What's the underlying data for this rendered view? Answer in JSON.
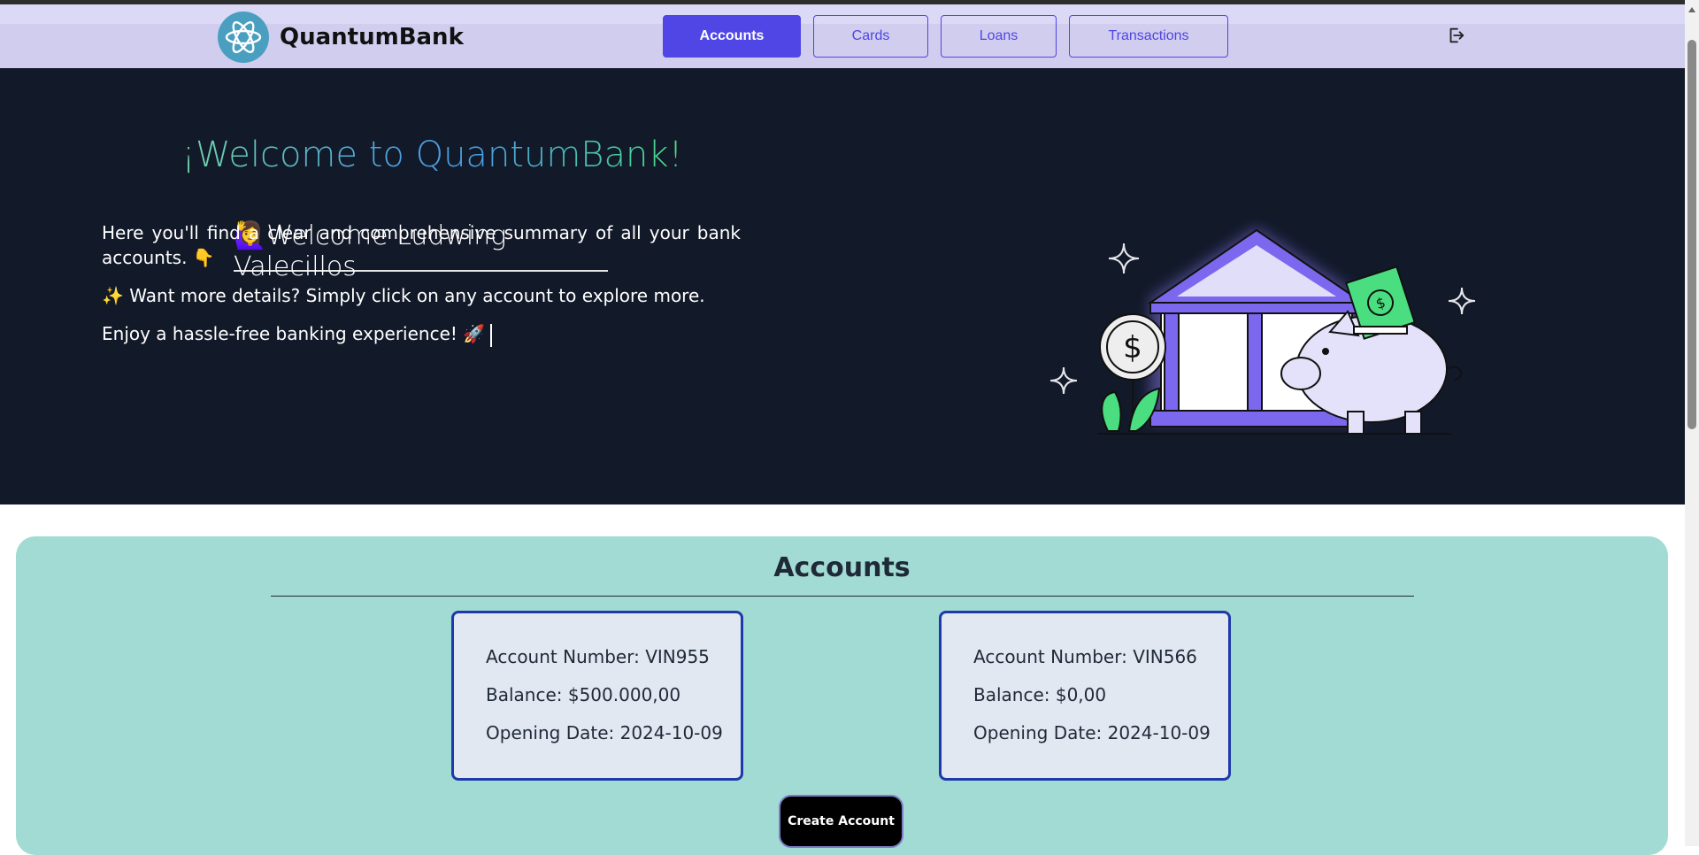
{
  "app": {
    "brand": "QuantumBank"
  },
  "nav": {
    "tabs": [
      {
        "label": "Accounts",
        "active": true
      },
      {
        "label": "Cards",
        "active": false
      },
      {
        "label": "Loans",
        "active": false
      },
      {
        "label": "Transactions",
        "active": false
      }
    ],
    "logout_icon": "logout-icon"
  },
  "hero": {
    "title": "¡Welcome to QuantumBank!",
    "welcome": "🙋‍♀️Welcome Ludwing Valecillos",
    "para1": "Here you'll find a clear and comprehensive summary of all your bank accounts. 👇",
    "para2": "✨ Want more details? Simply click on any account to explore more.",
    "para3": "Enjoy a hassle-free banking experience! 🚀"
  },
  "accounts": {
    "title": "Accounts",
    "items": [
      {
        "number": "Account Number: VIN955",
        "balance": "Balance: $500.000,00",
        "date": "Opening Date: 2024-10-09"
      },
      {
        "number": "Account Number: VIN566",
        "balance": "Balance: $0,00",
        "date": "Opening Date: 2024-10-09"
      }
    ],
    "create_label": "Create Account"
  },
  "colors": {
    "accent": "#4f46e5",
    "hero_bg": "#121929",
    "panel_bg": "#a2dbd3",
    "card_border": "#1e3aa8"
  }
}
